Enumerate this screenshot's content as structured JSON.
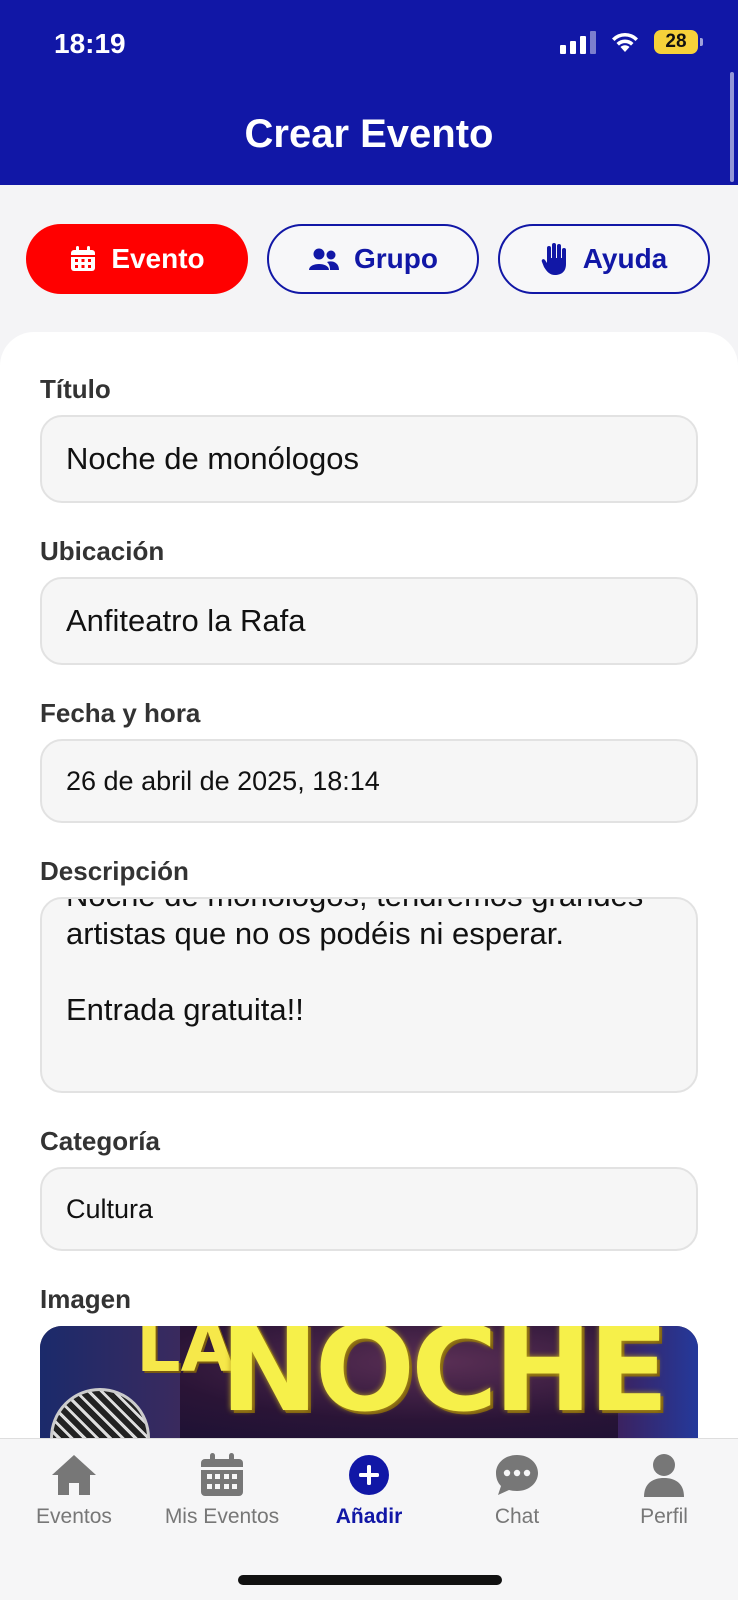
{
  "status_bar": {
    "time": "18:19",
    "battery": "28"
  },
  "header": {
    "title": "Crear Evento"
  },
  "segments": [
    {
      "label": "Evento",
      "icon": "calendar-icon",
      "active": true
    },
    {
      "label": "Grupo",
      "icon": "users-icon",
      "active": false
    },
    {
      "label": "Ayuda",
      "icon": "hand-icon",
      "active": false
    }
  ],
  "form": {
    "title_label": "Título",
    "title_value": "Noche de monólogos",
    "location_label": "Ubicación",
    "location_value": "Anfiteatro la Rafa",
    "datetime_label": "Fecha y hora",
    "datetime_value": "26 de abril de 2025, 18:14",
    "description_label": "Descripción",
    "description_value": "Noche de monólogos, tendremos grandes\nartistas que no os podéis ni esperar.\n\nEntrada gratuita!!",
    "category_label": "Categoría",
    "category_value": "Cultura",
    "image_label": "Imagen",
    "image_text_small": "LA",
    "image_text_big": "NOCHE"
  },
  "bottom_nav": [
    {
      "label": "Eventos",
      "icon": "home-icon",
      "active": false
    },
    {
      "label": "Mis Eventos",
      "icon": "calendar-icon",
      "active": false
    },
    {
      "label": "Añadir",
      "icon": "plus-circle-icon",
      "active": true
    },
    {
      "label": "Chat",
      "icon": "chat-bubble-icon",
      "active": false
    },
    {
      "label": "Perfil",
      "icon": "person-icon",
      "active": false
    }
  ],
  "colors": {
    "primary": "#1117a6",
    "accent": "#ff0000",
    "battery": "#f6d13a"
  }
}
